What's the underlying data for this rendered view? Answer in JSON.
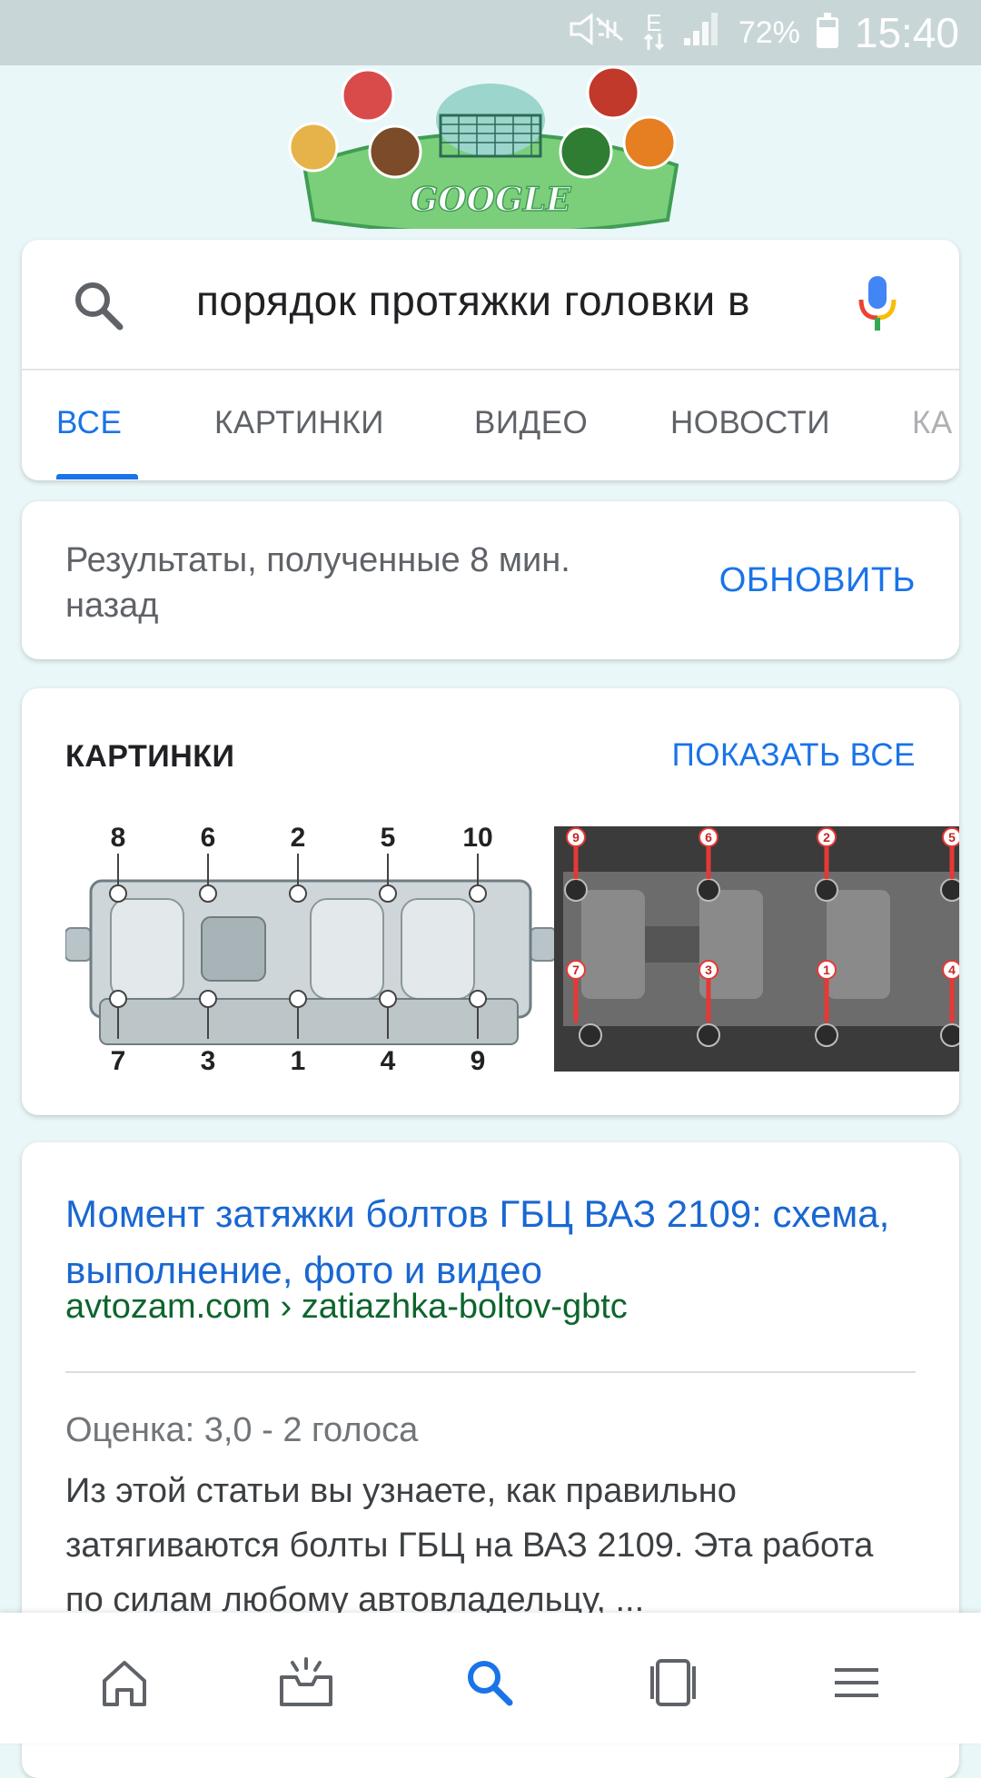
{
  "status_bar": {
    "battery_percent": "72%",
    "battery_level": 0.72,
    "time": "15:40",
    "network_label": "E"
  },
  "doodle": {
    "text": "GOOGLE"
  },
  "search": {
    "query": "порядок протяжки головки в",
    "tabs": [
      "ВСЕ",
      "КАРТИНКИ",
      "ВИДЕО",
      "НОВОСТИ",
      "КА"
    ]
  },
  "refresh": {
    "message": "Результаты, полученные 8 мин. назад",
    "button": "ОБНОВИТЬ"
  },
  "images": {
    "heading": "КАРТИНКИ",
    "show_all": "ПОКАЗАТЬ ВСЕ",
    "diagram_top_numbers": [
      "8",
      "6",
      "2",
      "5",
      "10"
    ],
    "diagram_bottom_numbers": [
      "7",
      "3",
      "1",
      "4",
      "9"
    ],
    "photo_top_numbers": [
      "9",
      "6",
      "2",
      "5"
    ],
    "photo_bottom_numbers": [
      "7",
      "3",
      "1",
      "4"
    ]
  },
  "result": {
    "title": "Момент затяжки болтов ГБЦ ВАЗ 2109: схема, выполнение, фото и видео",
    "url": "avtozam.com › zatiazhka-boltov-gbtc",
    "rating": "Оценка: 3,0 - 2 голоса",
    "snippet": "Из этой статьи вы узнаете, как правильно затягиваются болты ГБЦ на ВАЗ 2109. Эта работа по силам любому автовладельцу, ..."
  },
  "colors": {
    "accent": "#1a73e8",
    "link": "#1967d2",
    "url_green": "#0d652d",
    "status_bar": "#c9d6d7"
  }
}
